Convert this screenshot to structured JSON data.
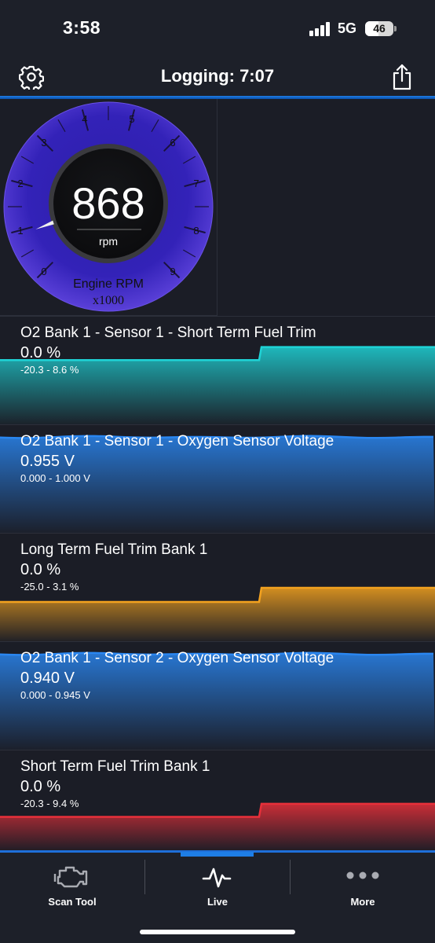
{
  "status_bar": {
    "time": "3:58",
    "network": "5G",
    "battery": "46"
  },
  "header": {
    "title": "Logging:  7:07",
    "settings_icon": "gear-icon",
    "share_icon": "share-icon"
  },
  "gauge": {
    "value": "868",
    "unit": "rpm",
    "label": "Engine RPM",
    "multiplier": "x1000",
    "ticks": [
      "0",
      "1",
      "2",
      "3",
      "4",
      "5",
      "6",
      "7",
      "8",
      "9"
    ],
    "needle_value": 0.868
  },
  "pids": [
    {
      "name": "O2 Bank 1 - Sensor 1 - Short Term Fuel Trim",
      "value": "0.0 %",
      "range": "-20.3 - 8.6 %",
      "color": "#1fd3d6"
    },
    {
      "name": "O2 Bank 1 - Sensor 1 - Oxygen Sensor Voltage",
      "value": "0.955 V",
      "range": "0.000 - 1.000 V",
      "color": "#2a86f0"
    },
    {
      "name": "Long Term Fuel Trim Bank 1",
      "value": "0.0 %",
      "range": "-25.0 - 3.1 %",
      "color": "#f3a21f"
    },
    {
      "name": "O2 Bank 1 - Sensor 2 - Oxygen Sensor Voltage",
      "value": "0.940 V",
      "range": "0.000 - 0.945 V",
      "color": "#2a86f0"
    },
    {
      "name": "Short Term Fuel Trim Bank 1",
      "value": "0.0 %",
      "range": "-20.3 - 9.4 %",
      "color": "#e8303a"
    }
  ],
  "tabs": [
    {
      "label": "Scan Tool",
      "icon": "engine-icon",
      "active": false
    },
    {
      "label": "Live",
      "icon": "pulse-icon",
      "active": true
    },
    {
      "label": "More",
      "icon": "ellipsis-icon",
      "active": false
    }
  ]
}
